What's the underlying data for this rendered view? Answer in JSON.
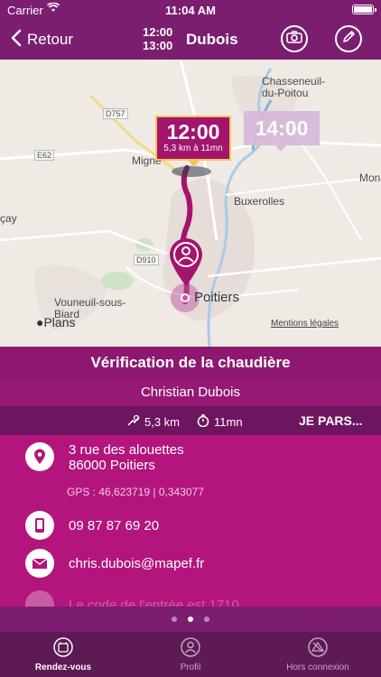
{
  "status_bar": {
    "carrier": "Carrier",
    "time": "11:04 AM"
  },
  "header": {
    "back_label": "Retour",
    "start_time": "12:00",
    "end_time": "13:00",
    "client_name": "Dubois",
    "camera_icon": "camera-icon",
    "edit_icon": "pencil-icon"
  },
  "map": {
    "places": {
      "chasseneuil": "Chasseneuil-du-Poitou",
      "migne": "Migné",
      "buxerolles": "Buxerolles",
      "poitiers": "Poitiers",
      "vouneuil": "Vouneuil-sous-Biard",
      "mon": "Mon",
      "ecay": "çay"
    },
    "roads": {
      "d757": "D757",
      "e62": "E62",
      "d910": "D910"
    },
    "bubble_time": "12:00",
    "bubble_info": "5,3 km à 11mn",
    "bubble_alt_time": "14:00",
    "maps_brand": "Plans",
    "legal_link": "Mentions légales",
    "route_color": "#a3146d",
    "pin_icon": "user-pin-icon"
  },
  "appointment": {
    "title": "Vérification de la chaudière",
    "client": "Christian Dubois",
    "distance": "5,3 km",
    "duration": "11mn",
    "go_label": "JE PARS..."
  },
  "details": {
    "address_line1": "3 rue des alouettes",
    "address_line2": "86000 Poitiers",
    "gps": "GPS : 46,623719 | 0,343077",
    "phone": "09 87 87 69 20",
    "email": "chris.dubois@mapef.fr",
    "note": "Le code de l'entrée est 1710"
  },
  "pager": {
    "count": 3,
    "active": 2
  },
  "tabs": [
    {
      "label": "Rendez-vous",
      "icon": "calendar-icon",
      "active": true
    },
    {
      "label": "Profil",
      "icon": "profile-icon",
      "active": false
    },
    {
      "label": "Hors connexion",
      "icon": "offline-icon",
      "active": false
    }
  ],
  "colors": {
    "header": "#7b1e6f",
    "accent": "#b3157d",
    "bubble_border": "#f3c45a"
  }
}
